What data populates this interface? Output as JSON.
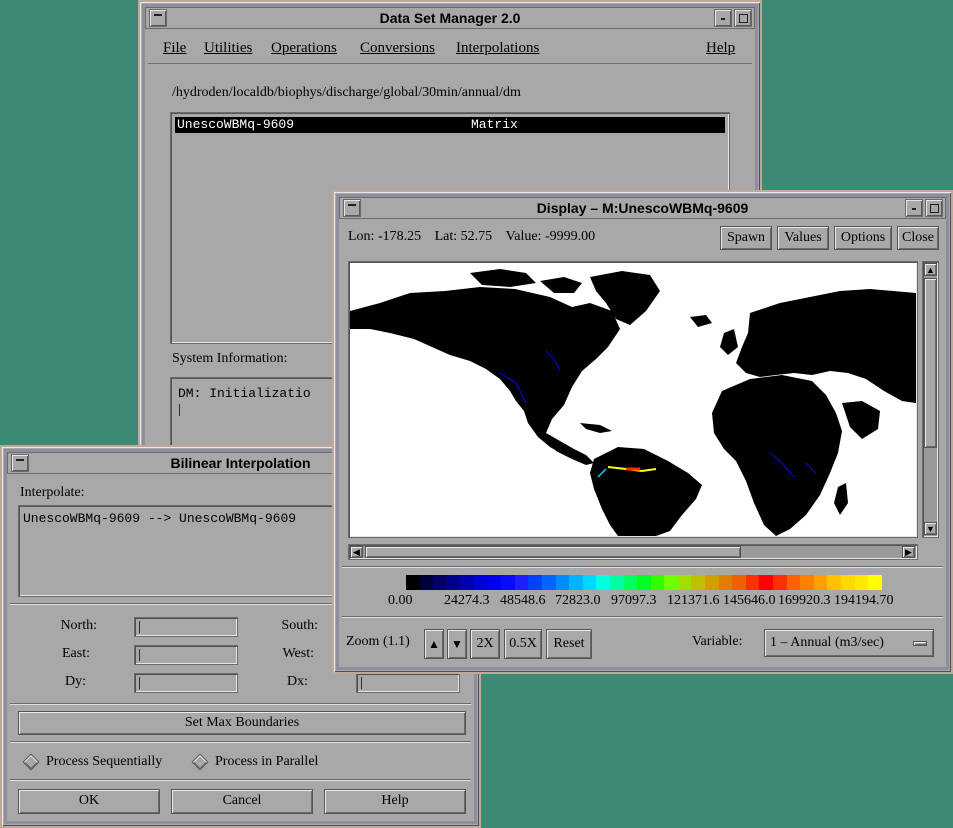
{
  "dsm": {
    "title": "Data Set Manager 2.0",
    "menu": {
      "file": "File",
      "utilities": "Utilities",
      "operations": "Operations",
      "conversions": "Conversions",
      "interpolations": "Interpolations",
      "help": "Help"
    },
    "path": "/hydroden/localdb/biophys/discharge/global/30min/annual/dm",
    "dataset_list": [
      {
        "name": "UnescoWBMq-9609",
        "type": "Matrix",
        "selected": true
      }
    ],
    "system_info_label": "System Information:",
    "system_info_text": "DM: Initializatio"
  },
  "display": {
    "title": "Display – M:UnescoWBMq-9609",
    "lon_label": "Lon:",
    "lon_value": "-178.25",
    "lat_label": "Lat:",
    "lat_value": "52.75",
    "value_label": "Value:",
    "value_value": "-9999.00",
    "buttons": {
      "spawn": "Spawn",
      "values": "Values",
      "options": "Options",
      "close": "Close"
    },
    "colorbar": {
      "colors": [
        "#000000",
        "#00003a",
        "#000066",
        "#00008c",
        "#0000b4",
        "#0000d8",
        "#0000ee",
        "#0a0aff",
        "#1e1eff",
        "#0040ff",
        "#0066ff",
        "#008cff",
        "#00b4ff",
        "#00d8ff",
        "#00ffe0",
        "#00ffa0",
        "#00ff60",
        "#00ff20",
        "#30ff00",
        "#70ff00",
        "#a0e000",
        "#c0c000",
        "#d0a000",
        "#e08000",
        "#f06000",
        "#ff3000",
        "#ff0000",
        "#ff3000",
        "#ff6000",
        "#ff8000",
        "#ffa000",
        "#ffc000",
        "#ffd800",
        "#ffe800",
        "#ffff00"
      ],
      "labels": [
        "0.00",
        "24274.3",
        "48548.6",
        "72823.0",
        "97097.3",
        "121371.6",
        "145646.0",
        "169920.3",
        "194194.70"
      ]
    },
    "zoom_label": "Zoom (1.1)",
    "zoom_up": "▲",
    "zoom_down": "▼",
    "zoom_2x": "2X",
    "zoom_half": "0.5X",
    "reset": "Reset",
    "variable_label": "Variable:",
    "variable_value": "1 – Annual (m3/sec)"
  },
  "bilinear": {
    "title": "Bilinear Interpolation",
    "interpolate_label": "Interpolate:",
    "interpolate_text": "UnescoWBMq-9609 --> UnescoWBMq-9609",
    "north_label": "North:",
    "south_label": "South:",
    "east_label": "East:",
    "west_label": "West:",
    "dy_label": "Dy:",
    "dx_label": "Dx:",
    "max_boundaries": "Set Max Boundaries",
    "process_sequential": "Process Sequentially",
    "process_parallel": "Process in Parallel",
    "ok": "OK",
    "cancel": "Cancel",
    "help": "Help"
  }
}
